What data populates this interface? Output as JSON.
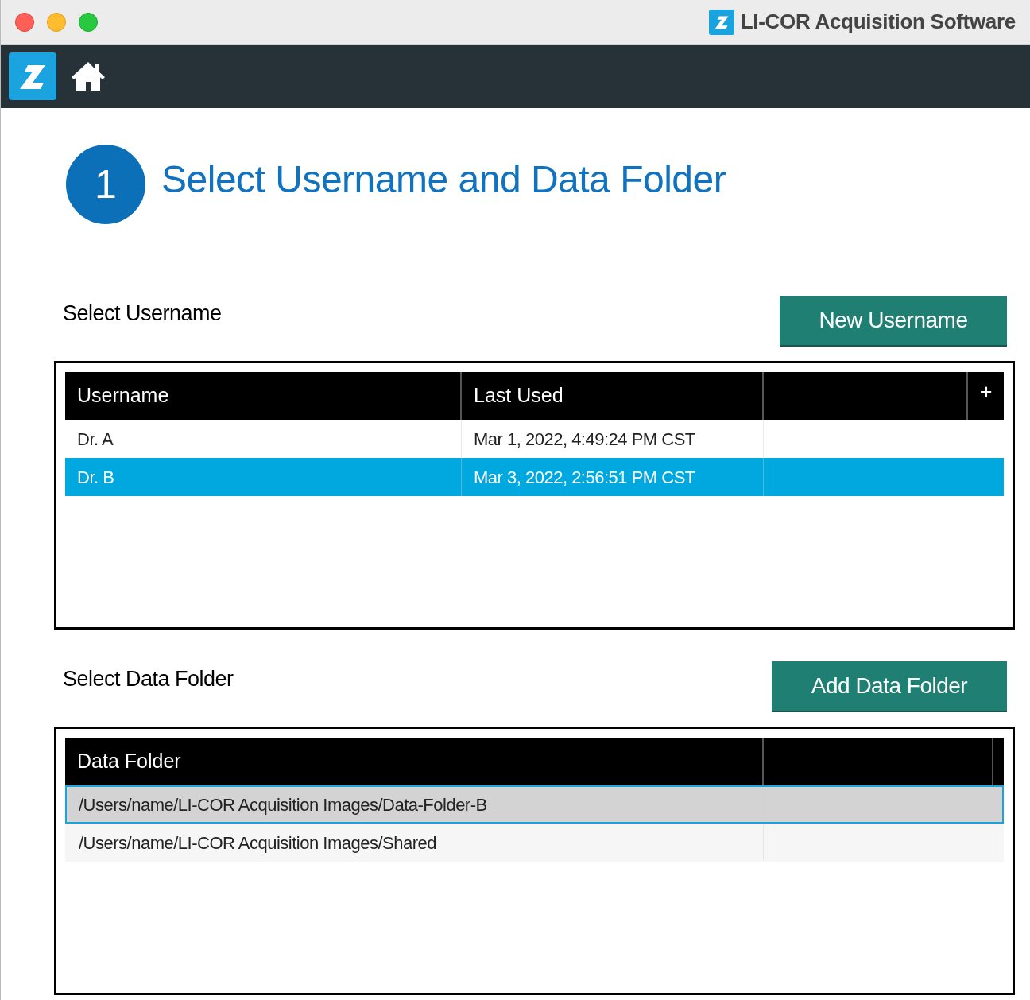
{
  "window": {
    "title": "LI-COR Acquisition Software"
  },
  "step": {
    "number": "1",
    "heading": "Select Username and Data Folder"
  },
  "usernames": {
    "label": "Select Username",
    "button": "New Username",
    "columns": [
      "Username",
      "Last Used"
    ],
    "add_column": "+",
    "rows": [
      {
        "cells": [
          "Dr. A",
          "Mar 1, 2022, 4:49:24 PM CST"
        ],
        "selected": false
      },
      {
        "cells": [
          "Dr. B",
          "Mar 3, 2022, 2:56:51 PM CST"
        ],
        "selected": true
      }
    ]
  },
  "folders": {
    "label": "Select Data Folder",
    "button": "Add Data Folder",
    "columns": [
      "Data Folder"
    ],
    "rows": [
      {
        "cells": [
          "/Users/name/LI-COR Acquisition Images/Data-Folder-B"
        ],
        "selected": true
      },
      {
        "cells": [
          "/Users/name/LI-COR Acquisition Images/Shared"
        ],
        "selected": false
      }
    ]
  }
}
